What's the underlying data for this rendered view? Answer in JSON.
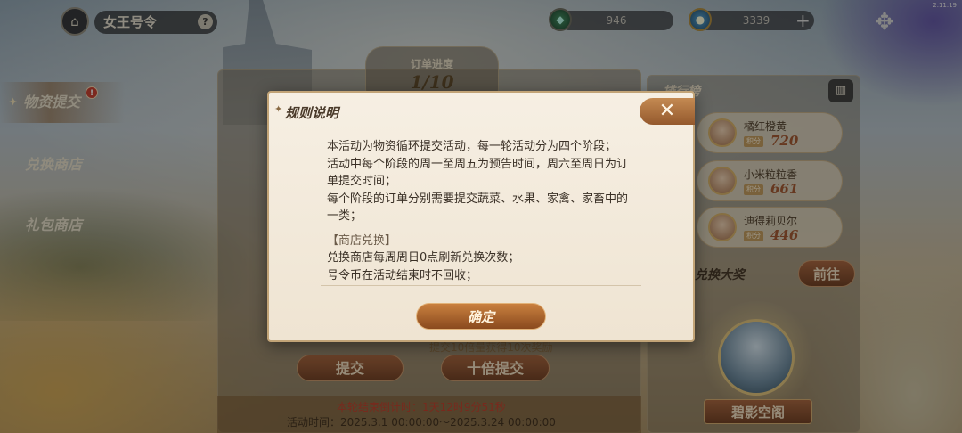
{
  "version": "2.11.19",
  "header": {
    "title": "女王号令",
    "help": "?",
    "gem_count": "946",
    "coin_count": "3339",
    "add": "+"
  },
  "sidebar": {
    "items": [
      {
        "label": "物资提交",
        "active": true,
        "badge": "!"
      },
      {
        "label": "兑换商店",
        "active": false
      },
      {
        "label": "礼包商店",
        "active": false
      }
    ]
  },
  "order": {
    "label": "订单进度",
    "value": "1/10"
  },
  "actions": {
    "reward_note": "提交10倍量获得10次奖励",
    "submit_label": "提交",
    "ten_submit_label": "十倍提交",
    "countdown": "本轮结束倒计时：1天12时9分51秒",
    "event_time": "活动时间：2025.3.1 00:00:00～2025.3.24 00:00:00"
  },
  "leaderboard": {
    "title": "排行榜",
    "tag": "积分",
    "entries": [
      {
        "name": "橘红橙黄",
        "score": "720"
      },
      {
        "name": "小米粒粒香",
        "score": "661"
      },
      {
        "name": "迪得莉贝尔",
        "score": "446"
      }
    ]
  },
  "prize": {
    "title": "兑换大奖",
    "goto_label": "前往",
    "name": "碧影空阁"
  },
  "modal": {
    "title": "规则说明",
    "close": "✕",
    "lines": [
      "本活动为物资循环提交活动，每一轮活动分为四个阶段；",
      "活动中每个阶段的周一至周五为预告时间，周六至周日为订",
      "单提交时间；",
      "每个阶段的订单分别需要提交蔬菜、水果、家禽、家畜中的",
      "一类；"
    ],
    "section_title": "【商店兑换】",
    "section_lines": [
      "兑换商店每周周日0点刷新兑换次数；",
      "号令币在活动结束时不回收；"
    ],
    "confirm_label": "确定"
  },
  "colors": {
    "accent_brown": "#8a4a1e",
    "countdown_red": "#c23a26",
    "score_red": "#a2542c"
  }
}
